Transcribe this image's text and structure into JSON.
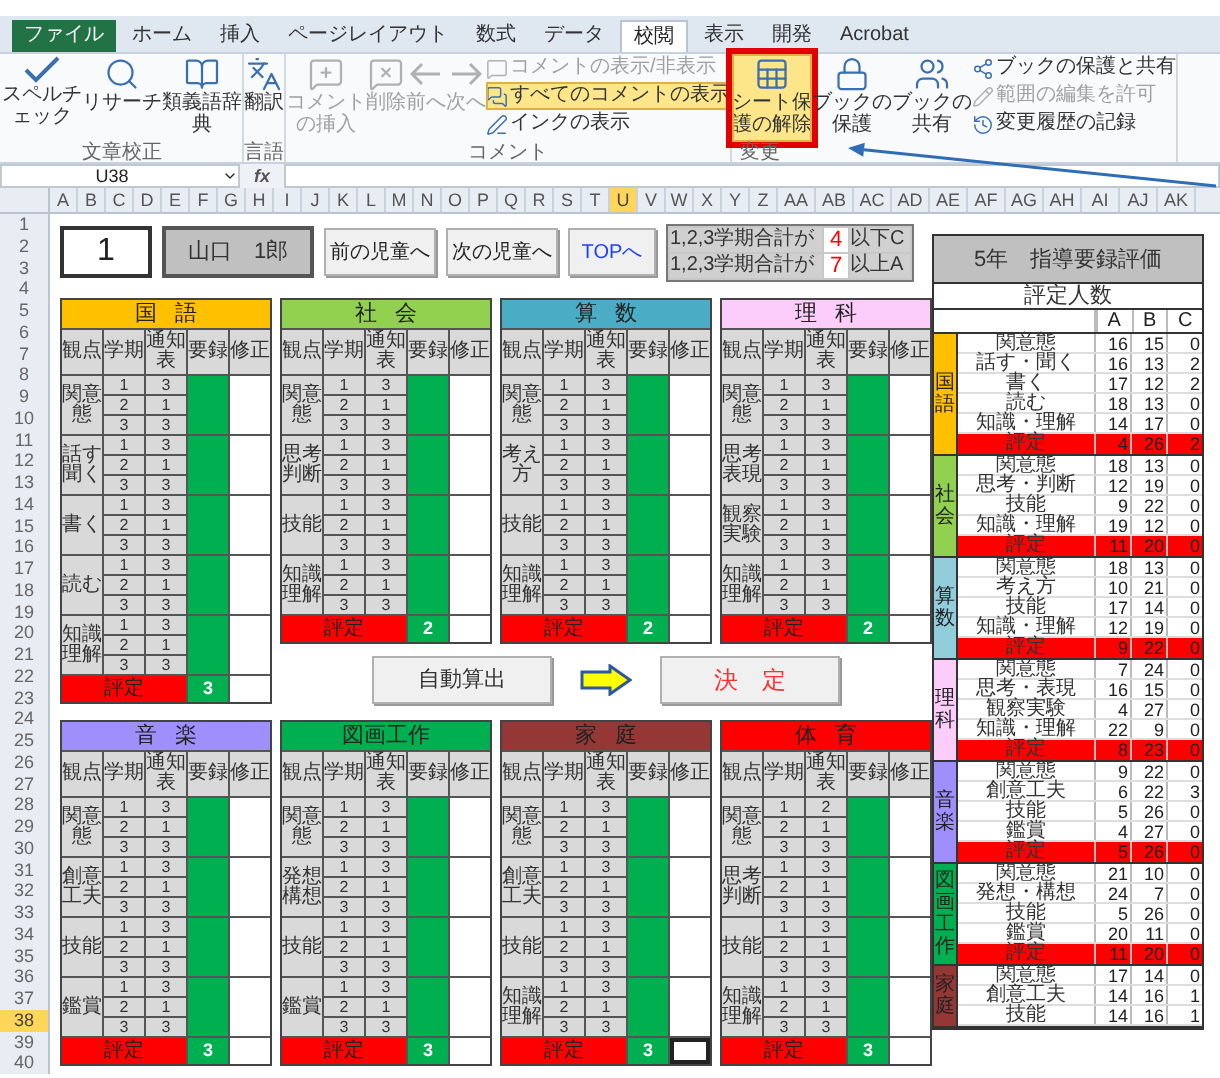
{
  "ribbon": {
    "tabs": [
      {
        "label": "ファイル",
        "kind": "file",
        "selected": false
      },
      {
        "label": "ホーム",
        "kind": "tab",
        "selected": false
      },
      {
        "label": "挿入",
        "kind": "tab",
        "selected": false
      },
      {
        "label": "ページレイアウト",
        "kind": "tab",
        "selected": false
      },
      {
        "label": "数式",
        "kind": "tab",
        "selected": false
      },
      {
        "label": "データ",
        "kind": "tab",
        "selected": false
      },
      {
        "label": "校閲",
        "kind": "tab",
        "selected": true
      },
      {
        "label": "表示",
        "kind": "tab",
        "selected": false
      },
      {
        "label": "開発",
        "kind": "tab",
        "selected": false
      },
      {
        "label": "Acrobat",
        "kind": "tab",
        "selected": false
      }
    ],
    "groups": [
      {
        "label": "文章校正",
        "items": [
          {
            "kind": "large",
            "label": "スペルチェック",
            "disabled": false,
            "highlighted": false,
            "annotated": false
          },
          {
            "kind": "large",
            "label": "リサーチ",
            "disabled": false,
            "highlighted": false,
            "annotated": false
          },
          {
            "kind": "large",
            "label": "類義語辞典",
            "disabled": false,
            "highlighted": false,
            "annotated": false
          }
        ]
      },
      {
        "label": "言語",
        "items": [
          {
            "kind": "large",
            "label": "翻訳",
            "disabled": false,
            "highlighted": false,
            "annotated": false
          }
        ]
      },
      {
        "label": "コメント",
        "items": [
          {
            "kind": "large",
            "label": "コメントの挿入",
            "disabled": true,
            "highlighted": false,
            "annotated": false
          },
          {
            "kind": "large",
            "label": "削除",
            "disabled": true,
            "highlighted": false,
            "annotated": false
          },
          {
            "kind": "large",
            "label": "前へ",
            "disabled": true,
            "highlighted": false,
            "annotated": false
          },
          {
            "kind": "large",
            "label": "次へ",
            "disabled": true,
            "highlighted": false,
            "annotated": false
          },
          {
            "kind": "small",
            "label": "コメントの表示/非表示",
            "disabled": true,
            "highlighted": false,
            "annotated": false
          },
          {
            "kind": "small",
            "label": "すべてのコメントの表示",
            "disabled": false,
            "highlighted": true,
            "annotated": false
          },
          {
            "kind": "small",
            "label": "インクの表示",
            "disabled": false,
            "highlighted": false,
            "annotated": false
          }
        ]
      },
      {
        "label": "変更",
        "items": [
          {
            "kind": "large",
            "label": "シート保護の解除",
            "disabled": false,
            "highlighted": true,
            "annotated": true
          },
          {
            "kind": "large",
            "label": "ブックの保護",
            "disabled": false,
            "highlighted": false,
            "annotated": false
          },
          {
            "kind": "large",
            "label": "ブックの共有",
            "disabled": false,
            "highlighted": false,
            "annotated": false
          },
          {
            "kind": "small",
            "label": "ブックの保護と共有",
            "disabled": false,
            "highlighted": false,
            "annotated": false
          },
          {
            "kind": "small",
            "label": "範囲の編集を許可",
            "disabled": true,
            "highlighted": false,
            "annotated": false
          },
          {
            "kind": "small",
            "label": "変更履歴の記録",
            "disabled": false,
            "highlighted": false,
            "annotated": false
          }
        ]
      }
    ]
  },
  "annotation_arrow": true,
  "formula_bar": {
    "name_box": "U38",
    "function_label": "fx"
  },
  "columns": [
    {
      "label": "A",
      "selected": false
    },
    {
      "label": "B",
      "selected": false
    },
    {
      "label": "C",
      "selected": false
    },
    {
      "label": "D",
      "selected": false
    },
    {
      "label": "E",
      "selected": false
    },
    {
      "label": "F",
      "selected": false
    },
    {
      "label": "G",
      "selected": false
    },
    {
      "label": "H",
      "selected": false
    },
    {
      "label": "I",
      "selected": false
    },
    {
      "label": "J",
      "selected": false
    },
    {
      "label": "K",
      "selected": false
    },
    {
      "label": "L",
      "selected": false
    },
    {
      "label": "M",
      "selected": false
    },
    {
      "label": "N",
      "selected": false
    },
    {
      "label": "O",
      "selected": false
    },
    {
      "label": "P",
      "selected": false
    },
    {
      "label": "Q",
      "selected": false
    },
    {
      "label": "R",
      "selected": false
    },
    {
      "label": "S",
      "selected": false
    },
    {
      "label": "T",
      "selected": false
    },
    {
      "label": "U",
      "selected": true
    },
    {
      "label": "V",
      "selected": false
    },
    {
      "label": "W",
      "selected": false
    },
    {
      "label": "X",
      "selected": false
    },
    {
      "label": "Y",
      "selected": false
    },
    {
      "label": "Z",
      "selected": false
    },
    {
      "label": "AA",
      "selected": false
    },
    {
      "label": "AB",
      "selected": false
    },
    {
      "label": "AC",
      "selected": false
    },
    {
      "label": "AD",
      "selected": false
    },
    {
      "label": "AE",
      "selected": false
    },
    {
      "label": "AF",
      "selected": false
    },
    {
      "label": "AG",
      "selected": false
    },
    {
      "label": "AH",
      "selected": false
    },
    {
      "label": "AI",
      "selected": false
    },
    {
      "label": "AJ",
      "selected": false
    },
    {
      "label": "AK",
      "selected": false
    }
  ],
  "rows": [
    {
      "label": "1",
      "selected": false
    },
    {
      "label": "2",
      "selected": false
    },
    {
      "label": "3",
      "selected": false
    },
    {
      "label": "4",
      "selected": false
    },
    {
      "label": "5",
      "selected": false
    },
    {
      "label": "6",
      "selected": false
    },
    {
      "label": "7",
      "selected": false
    },
    {
      "label": "8",
      "selected": false
    },
    {
      "label": "9",
      "selected": false
    },
    {
      "label": "10",
      "selected": false
    },
    {
      "label": "11",
      "selected": false
    },
    {
      "label": "12",
      "selected": false
    },
    {
      "label": "13",
      "selected": false
    },
    {
      "label": "14",
      "selected": false
    },
    {
      "label": "15",
      "selected": false
    },
    {
      "label": "16",
      "selected": false
    },
    {
      "label": "17",
      "selected": false
    },
    {
      "label": "18",
      "selected": false
    },
    {
      "label": "19",
      "selected": false
    },
    {
      "label": "20",
      "selected": false
    },
    {
      "label": "21",
      "selected": false
    },
    {
      "label": "22",
      "selected": false
    },
    {
      "label": "23",
      "selected": false
    },
    {
      "label": "24",
      "selected": false
    },
    {
      "label": "25",
      "selected": false
    },
    {
      "label": "26",
      "selected": false
    },
    {
      "label": "27",
      "selected": false
    },
    {
      "label": "28",
      "selected": false
    },
    {
      "label": "29",
      "selected": false
    },
    {
      "label": "30",
      "selected": false
    },
    {
      "label": "31",
      "selected": false
    },
    {
      "label": "32",
      "selected": false
    },
    {
      "label": "33",
      "selected": false
    },
    {
      "label": "34",
      "selected": false
    },
    {
      "label": "35",
      "selected": false
    },
    {
      "label": "36",
      "selected": false
    },
    {
      "label": "37",
      "selected": false
    },
    {
      "label": "38",
      "selected": true
    },
    {
      "label": "39",
      "selected": false
    },
    {
      "label": "40",
      "selected": false
    }
  ],
  "student": {
    "number": "1",
    "name": "山口　1郎",
    "prev_button": "前の児童へ",
    "next_button": "次の児童へ",
    "top_button": "TOPへ"
  },
  "criteria": [
    {
      "label": "1,2,3学期合計が",
      "value": "4",
      "suffix": "以下C"
    },
    {
      "label": "1,2,3学期合計が",
      "value": "7",
      "suffix": "以上A"
    }
  ],
  "subjects": [
    {
      "name": "国語",
      "color": "#ffc000",
      "columns": [
        "観点",
        "学期",
        "通知表",
        "要録",
        "修正"
      ],
      "groups": [
        {
          "label": "関意態",
          "rows": [
            {
              "term": "1",
              "grade": "3"
            },
            {
              "term": "2",
              "grade": "1"
            },
            {
              "term": "3",
              "grade": "3"
            }
          ]
        },
        {
          "label": "話す聞く",
          "rows": [
            {
              "term": "1",
              "grade": "3"
            },
            {
              "term": "2",
              "grade": "1"
            },
            {
              "term": "3",
              "grade": "3"
            }
          ]
        },
        {
          "label": "書く",
          "rows": [
            {
              "term": "1",
              "grade": "3"
            },
            {
              "term": "2",
              "grade": "1"
            },
            {
              "term": "3",
              "grade": "3"
            }
          ]
        },
        {
          "label": "読む",
          "rows": [
            {
              "term": "1",
              "grade": "3"
            },
            {
              "term": "2",
              "grade": "1"
            },
            {
              "term": "3",
              "grade": "3"
            }
          ]
        },
        {
          "label": "知識理解",
          "rows": [
            {
              "term": "1",
              "grade": "3"
            },
            {
              "term": "2",
              "grade": "1"
            },
            {
              "term": "3",
              "grade": "3"
            }
          ]
        }
      ],
      "rating_label": "評定",
      "result": "3",
      "correction_selected": false
    },
    {
      "name": "社会",
      "color": "#92d050",
      "columns": [
        "観点",
        "学期",
        "通知表",
        "要録",
        "修正"
      ],
      "groups": [
        {
          "label": "関意態",
          "rows": [
            {
              "term": "1",
              "grade": "3"
            },
            {
              "term": "2",
              "grade": "1"
            },
            {
              "term": "3",
              "grade": "3"
            }
          ]
        },
        {
          "label": "思考判断",
          "rows": [
            {
              "term": "1",
              "grade": "3"
            },
            {
              "term": "2",
              "grade": "1"
            },
            {
              "term": "3",
              "grade": "3"
            }
          ]
        },
        {
          "label": "技能",
          "rows": [
            {
              "term": "1",
              "grade": "3"
            },
            {
              "term": "2",
              "grade": "1"
            },
            {
              "term": "3",
              "grade": "3"
            }
          ]
        },
        {
          "label": "知識理解",
          "rows": [
            {
              "term": "1",
              "grade": "3"
            },
            {
              "term": "2",
              "grade": "1"
            },
            {
              "term": "3",
              "grade": "3"
            }
          ]
        }
      ],
      "rating_label": "評定",
      "result": "2",
      "correction_selected": false
    },
    {
      "name": "算数",
      "color": "#4bacc6",
      "columns": [
        "観点",
        "学期",
        "通知表",
        "要録",
        "修正"
      ],
      "groups": [
        {
          "label": "関意態",
          "rows": [
            {
              "term": "1",
              "grade": "3"
            },
            {
              "term": "2",
              "grade": "1"
            },
            {
              "term": "3",
              "grade": "3"
            }
          ]
        },
        {
          "label": "考え方",
          "rows": [
            {
              "term": "1",
              "grade": "3"
            },
            {
              "term": "2",
              "grade": "1"
            },
            {
              "term": "3",
              "grade": "3"
            }
          ]
        },
        {
          "label": "技能",
          "rows": [
            {
              "term": "1",
              "grade": "3"
            },
            {
              "term": "2",
              "grade": "1"
            },
            {
              "term": "3",
              "grade": "3"
            }
          ]
        },
        {
          "label": "知識理解",
          "rows": [
            {
              "term": "1",
              "grade": "3"
            },
            {
              "term": "2",
              "grade": "1"
            },
            {
              "term": "3",
              "grade": "3"
            }
          ]
        }
      ],
      "rating_label": "評定",
      "result": "2",
      "correction_selected": false
    },
    {
      "name": "理科",
      "color": "#fccdfb",
      "columns": [
        "観点",
        "学期",
        "通知表",
        "要録",
        "修正"
      ],
      "groups": [
        {
          "label": "関意態",
          "rows": [
            {
              "term": "1",
              "grade": "3"
            },
            {
              "term": "2",
              "grade": "1"
            },
            {
              "term": "3",
              "grade": "3"
            }
          ]
        },
        {
          "label": "思考表現",
          "rows": [
            {
              "term": "1",
              "grade": "3"
            },
            {
              "term": "2",
              "grade": "1"
            },
            {
              "term": "3",
              "grade": "3"
            }
          ]
        },
        {
          "label": "観察実験",
          "rows": [
            {
              "term": "1",
              "grade": "3"
            },
            {
              "term": "2",
              "grade": "1"
            },
            {
              "term": "3",
              "grade": "3"
            }
          ]
        },
        {
          "label": "知識理解",
          "rows": [
            {
              "term": "1",
              "grade": "3"
            },
            {
              "term": "2",
              "grade": "1"
            },
            {
              "term": "3",
              "grade": "3"
            }
          ]
        }
      ],
      "rating_label": "評定",
      "result": "2",
      "correction_selected": false
    },
    {
      "name": "音楽",
      "color": "#9f8ffc",
      "columns": [
        "観点",
        "学期",
        "通知表",
        "要録",
        "修正"
      ],
      "groups": [
        {
          "label": "関意態",
          "rows": [
            {
              "term": "1",
              "grade": "3"
            },
            {
              "term": "2",
              "grade": "1"
            },
            {
              "term": "3",
              "grade": "3"
            }
          ]
        },
        {
          "label": "創意工夫",
          "rows": [
            {
              "term": "1",
              "grade": "3"
            },
            {
              "term": "2",
              "grade": "1"
            },
            {
              "term": "3",
              "grade": "3"
            }
          ]
        },
        {
          "label": "技能",
          "rows": [
            {
              "term": "1",
              "grade": "3"
            },
            {
              "term": "2",
              "grade": "1"
            },
            {
              "term": "3",
              "grade": "3"
            }
          ]
        },
        {
          "label": "鑑賞",
          "rows": [
            {
              "term": "1",
              "grade": "3"
            },
            {
              "term": "2",
              "grade": "1"
            },
            {
              "term": "3",
              "grade": "3"
            }
          ]
        }
      ],
      "rating_label": "評定",
      "result": "3",
      "correction_selected": false
    },
    {
      "name": "図画工作",
      "color": "#00b050",
      "columns": [
        "観点",
        "学期",
        "通知表",
        "要録",
        "修正"
      ],
      "groups": [
        {
          "label": "関意態",
          "rows": [
            {
              "term": "1",
              "grade": "3"
            },
            {
              "term": "2",
              "grade": "1"
            },
            {
              "term": "3",
              "grade": "3"
            }
          ]
        },
        {
          "label": "発想構想",
          "rows": [
            {
              "term": "1",
              "grade": "3"
            },
            {
              "term": "2",
              "grade": "1"
            },
            {
              "term": "3",
              "grade": "3"
            }
          ]
        },
        {
          "label": "技能",
          "rows": [
            {
              "term": "1",
              "grade": "3"
            },
            {
              "term": "2",
              "grade": "1"
            },
            {
              "term": "3",
              "grade": "3"
            }
          ]
        },
        {
          "label": "鑑賞",
          "rows": [
            {
              "term": "1",
              "grade": "3"
            },
            {
              "term": "2",
              "grade": "1"
            },
            {
              "term": "3",
              "grade": "3"
            }
          ]
        }
      ],
      "rating_label": "評定",
      "result": "3",
      "correction_selected": false
    },
    {
      "name": "家庭",
      "color": "#953735",
      "columns": [
        "観点",
        "学期",
        "通知表",
        "要録",
        "修正"
      ],
      "groups": [
        {
          "label": "関意態",
          "rows": [
            {
              "term": "1",
              "grade": "3"
            },
            {
              "term": "2",
              "grade": "1"
            },
            {
              "term": "3",
              "grade": "3"
            }
          ]
        },
        {
          "label": "創意工夫",
          "rows": [
            {
              "term": "1",
              "grade": "3"
            },
            {
              "term": "2",
              "grade": "1"
            },
            {
              "term": "3",
              "grade": "3"
            }
          ]
        },
        {
          "label": "技能",
          "rows": [
            {
              "term": "1",
              "grade": "3"
            },
            {
              "term": "2",
              "grade": "1"
            },
            {
              "term": "3",
              "grade": "3"
            }
          ]
        },
        {
          "label": "知識理解",
          "rows": [
            {
              "term": "1",
              "grade": "3"
            },
            {
              "term": "2",
              "grade": "1"
            },
            {
              "term": "3",
              "grade": "3"
            }
          ]
        }
      ],
      "rating_label": "評定",
      "result": "3",
      "correction_selected": true
    },
    {
      "name": "体育",
      "color": "#ff0000",
      "columns": [
        "観点",
        "学期",
        "通知表",
        "要録",
        "修正"
      ],
      "groups": [
        {
          "label": "関意態",
          "rows": [
            {
              "term": "1",
              "grade": "2"
            },
            {
              "term": "2",
              "grade": "1"
            },
            {
              "term": "3",
              "grade": "3"
            }
          ]
        },
        {
          "label": "思考判断",
          "rows": [
            {
              "term": "1",
              "grade": "3"
            },
            {
              "term": "2",
              "grade": "1"
            },
            {
              "term": "3",
              "grade": "3"
            }
          ]
        },
        {
          "label": "技能",
          "rows": [
            {
              "term": "1",
              "grade": "3"
            },
            {
              "term": "2",
              "grade": "1"
            },
            {
              "term": "3",
              "grade": "3"
            }
          ]
        },
        {
          "label": "知識理解",
          "rows": [
            {
              "term": "1",
              "grade": "3"
            },
            {
              "term": "2",
              "grade": "1"
            },
            {
              "term": "3",
              "grade": "3"
            }
          ]
        }
      ],
      "rating_label": "評定",
      "result": "3",
      "correction_selected": false
    }
  ],
  "actions": {
    "calculate_button": "自動算出",
    "decide_button": "決定"
  },
  "summary": {
    "title": "5年　指導要録評価",
    "subtitle": "評定人数",
    "columns": [
      "A",
      "B",
      "C"
    ],
    "subjects": [
      {
        "name": "国語",
        "color": "#ffc000",
        "items": [
          {
            "label": "関意態",
            "a": "16",
            "b": "15",
            "c": "0"
          },
          {
            "label": "話す・聞く",
            "a": "16",
            "b": "13",
            "c": "2"
          },
          {
            "label": "書く",
            "a": "17",
            "b": "12",
            "c": "2"
          },
          {
            "label": "読む",
            "a": "18",
            "b": "13",
            "c": "0"
          },
          {
            "label": "知識・理解",
            "a": "14",
            "b": "17",
            "c": "0"
          }
        ],
        "total": {
          "label": "評定",
          "a": "4",
          "b": "26",
          "c": "2"
        }
      },
      {
        "name": "社会",
        "color": "#92d050",
        "items": [
          {
            "label": "関意態",
            "a": "18",
            "b": "13",
            "c": "0"
          },
          {
            "label": "思考・判断",
            "a": "12",
            "b": "19",
            "c": "0"
          },
          {
            "label": "技能",
            "a": "9",
            "b": "22",
            "c": "0"
          },
          {
            "label": "知識・理解",
            "a": "19",
            "b": "12",
            "c": "0"
          }
        ],
        "total": {
          "label": "評定",
          "a": "11",
          "b": "20",
          "c": "0"
        }
      },
      {
        "name": "算数",
        "color": "#92cddc",
        "items": [
          {
            "label": "関意態",
            "a": "18",
            "b": "13",
            "c": "0"
          },
          {
            "label": "考え方",
            "a": "10",
            "b": "21",
            "c": "0"
          },
          {
            "label": "技能",
            "a": "17",
            "b": "14",
            "c": "0"
          },
          {
            "label": "知識・理解",
            "a": "12",
            "b": "19",
            "c": "0"
          }
        ],
        "total": {
          "label": "評定",
          "a": "9",
          "b": "22",
          "c": "0"
        }
      },
      {
        "name": "理科",
        "color": "#fccdfb",
        "items": [
          {
            "label": "関意態",
            "a": "7",
            "b": "24",
            "c": "0"
          },
          {
            "label": "思考・表現",
            "a": "16",
            "b": "15",
            "c": "0"
          },
          {
            "label": "観察実験",
            "a": "4",
            "b": "27",
            "c": "0"
          },
          {
            "label": "知識・理解",
            "a": "22",
            "b": "9",
            "c": "0"
          }
        ],
        "total": {
          "label": "評定",
          "a": "8",
          "b": "23",
          "c": "0"
        }
      },
      {
        "name": "音楽",
        "color": "#9f8ffc",
        "items": [
          {
            "label": "関意態",
            "a": "9",
            "b": "22",
            "c": "0"
          },
          {
            "label": "創意工夫",
            "a": "6",
            "b": "22",
            "c": "3"
          },
          {
            "label": "技能",
            "a": "5",
            "b": "26",
            "c": "0"
          },
          {
            "label": "鑑賞",
            "a": "4",
            "b": "27",
            "c": "0"
          }
        ],
        "total": {
          "label": "評定",
          "a": "5",
          "b": "26",
          "c": "0"
        }
      },
      {
        "name": "図画工作",
        "color": "#00b050",
        "items": [
          {
            "label": "関意態",
            "a": "21",
            "b": "10",
            "c": "0"
          },
          {
            "label": "発想・構想",
            "a": "24",
            "b": "7",
            "c": "0"
          },
          {
            "label": "技能",
            "a": "5",
            "b": "26",
            "c": "0"
          },
          {
            "label": "鑑賞",
            "a": "20",
            "b": "11",
            "c": "0"
          }
        ],
        "total": {
          "label": "評定",
          "a": "11",
          "b": "20",
          "c": "0"
        }
      },
      {
        "name": "家庭",
        "color": "#953735",
        "items": [
          {
            "label": "関意態",
            "a": "17",
            "b": "14",
            "c": "0"
          },
          {
            "label": "創意工夫",
            "a": "14",
            "b": "16",
            "c": "1"
          },
          {
            "label": "技能",
            "a": "14",
            "b": "16",
            "c": "1"
          }
        ]
      }
    ]
  }
}
